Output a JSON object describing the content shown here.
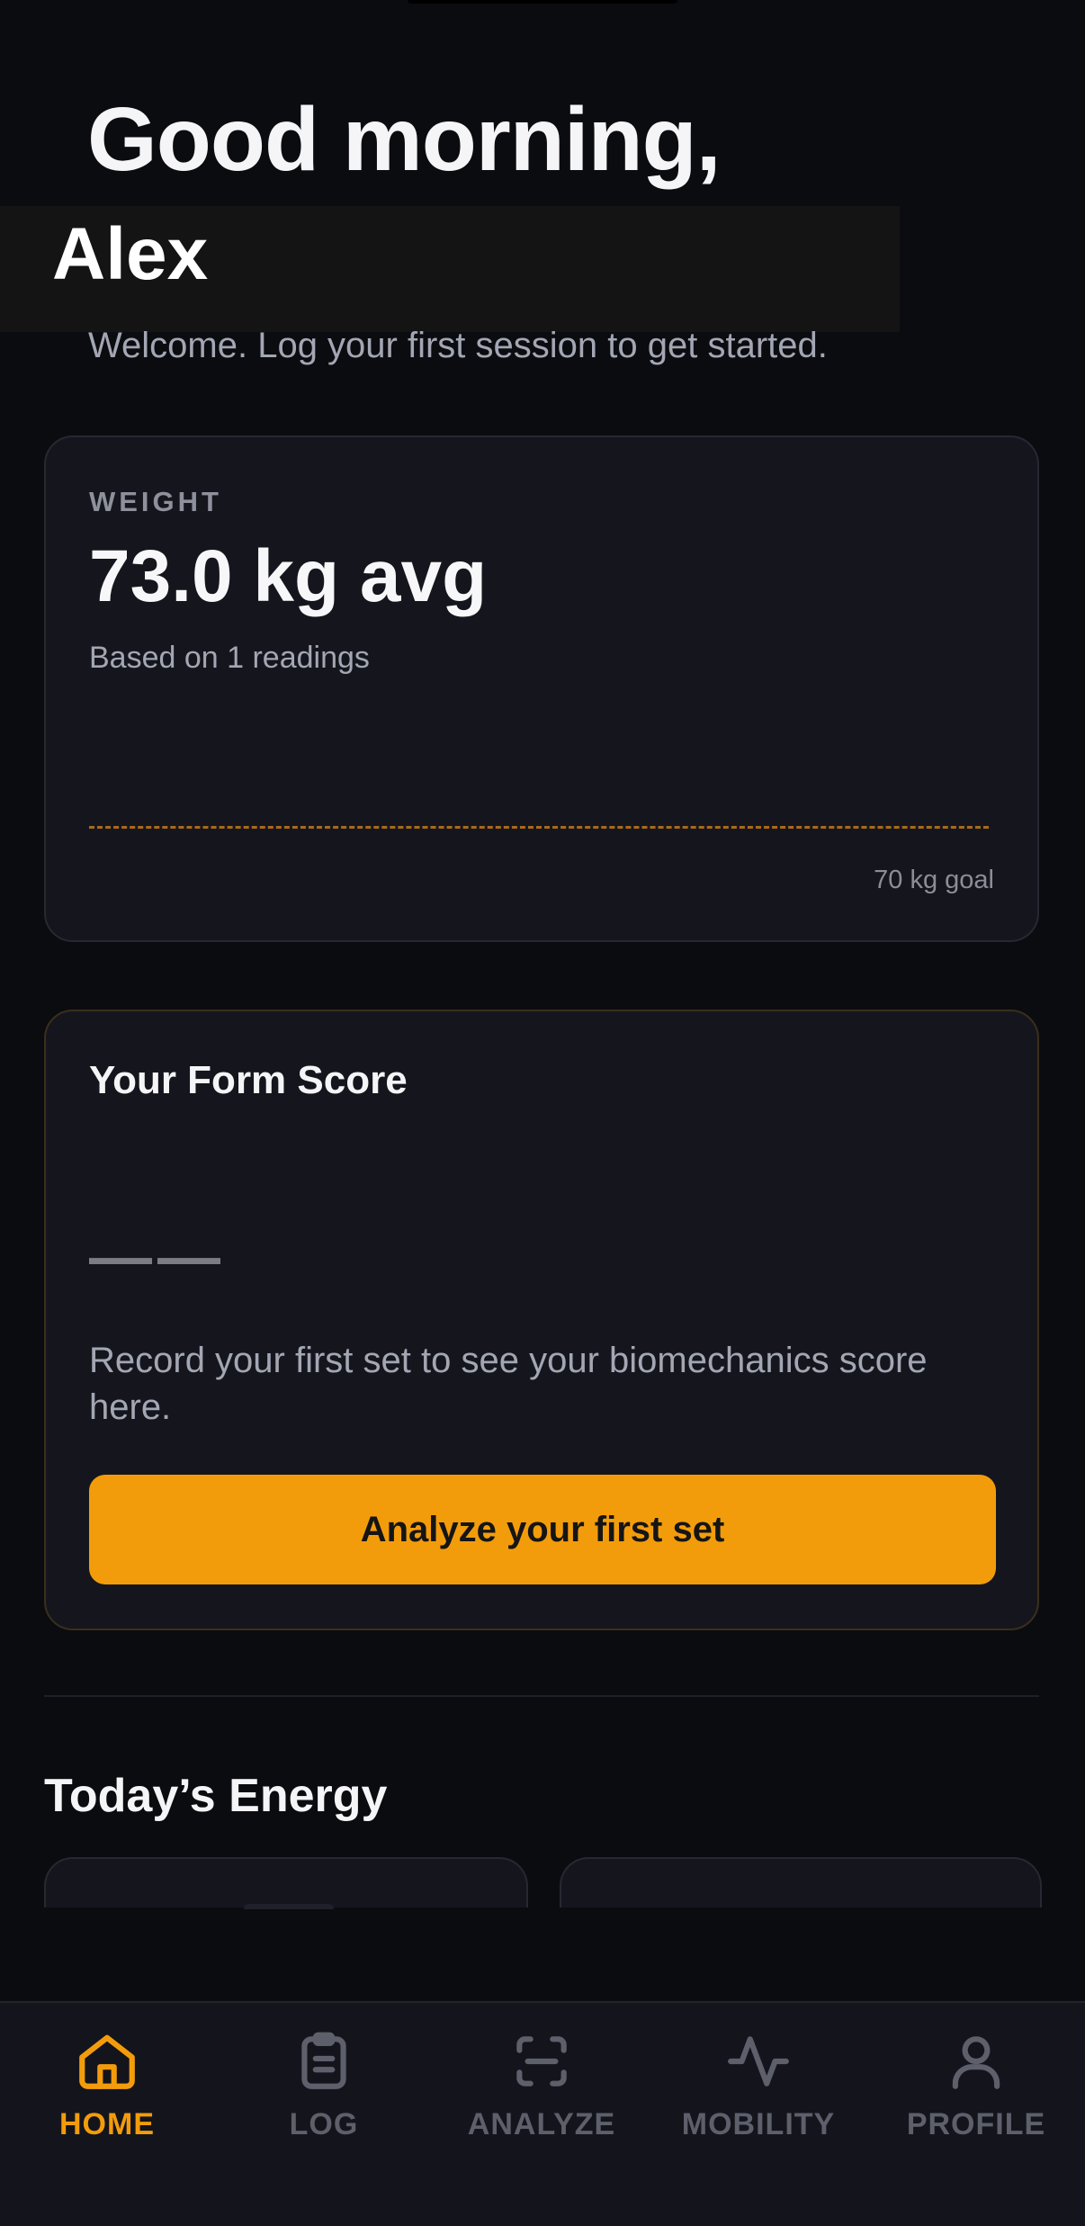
{
  "greeting": {
    "line1": "Good morning,",
    "name": "Alex",
    "welcome": "Welcome. Log your first session to get started."
  },
  "weight_card": {
    "label": "WEIGHT",
    "value": "73.0 kg avg",
    "subtitle": "Based on 1 readings",
    "goal": "70 kg goal"
  },
  "form_card": {
    "title": "Your Form Score",
    "score": "——",
    "description": "Record your first set to see your biomechanics score here.",
    "button": "Analyze your first set"
  },
  "energy": {
    "title": "Today’s Energy"
  },
  "tabs": [
    {
      "label": "HOME",
      "icon": "home-icon",
      "active": true
    },
    {
      "label": "LOG",
      "icon": "clipboard-icon",
      "active": false
    },
    {
      "label": "ANALYZE",
      "icon": "scan-icon",
      "active": false
    },
    {
      "label": "MOBILITY",
      "icon": "activity-icon",
      "active": false
    },
    {
      "label": "PROFILE",
      "icon": "user-icon",
      "active": false
    }
  ],
  "colors": {
    "accent": "#f39c0b",
    "background": "#0b0c10",
    "card": "#15161d",
    "inactive_tab": "#5d5f6b"
  }
}
